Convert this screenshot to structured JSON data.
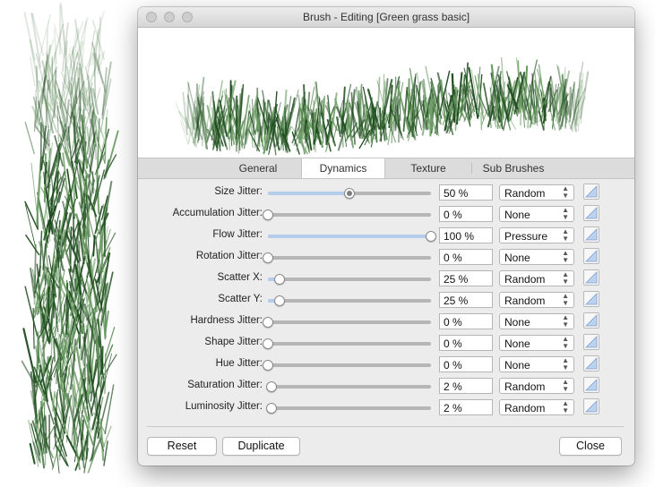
{
  "window": {
    "title": "Brush - Editing [Green grass basic]"
  },
  "tabs": [
    {
      "label": "General",
      "active": false
    },
    {
      "label": "Dynamics",
      "active": true
    },
    {
      "label": "Texture",
      "active": false
    },
    {
      "label": "Sub Brushes",
      "active": false
    }
  ],
  "rows": [
    {
      "label": "Size Jitter:",
      "value": "50 %",
      "level": 0.5,
      "mode": "Random"
    },
    {
      "label": "Accumulation Jitter:",
      "value": "0 %",
      "level": 0,
      "mode": "None"
    },
    {
      "label": "Flow Jitter:",
      "value": "100 %",
      "level": 1,
      "mode": "Pressure"
    },
    {
      "label": "Rotation Jitter:",
      "value": "0 %",
      "level": 0,
      "mode": "None"
    },
    {
      "label": "Scatter X:",
      "value": "25 %",
      "level": 0.07,
      "mode": "Random"
    },
    {
      "label": "Scatter Y:",
      "value": "25 %",
      "level": 0.07,
      "mode": "Random"
    },
    {
      "label": "Hardness Jitter:",
      "value": "0 %",
      "level": 0,
      "mode": "None"
    },
    {
      "label": "Shape Jitter:",
      "value": "0 %",
      "level": 0,
      "mode": "None"
    },
    {
      "label": "Hue Jitter:",
      "value": "0 %",
      "level": 0,
      "mode": "None"
    },
    {
      "label": "Saturation Jitter:",
      "value": "2 %",
      "level": 0.02,
      "mode": "Random"
    },
    {
      "label": "Luminosity Jitter:",
      "value": "2 %",
      "level": 0.02,
      "mode": "Random"
    }
  ],
  "buttons": {
    "reset": "Reset",
    "duplicate": "Duplicate",
    "close": "Close"
  },
  "colors": {
    "grass_dark": "#1f4d1f",
    "grass_light": "#6a9a62",
    "slider_fill": "#b4cdec"
  }
}
